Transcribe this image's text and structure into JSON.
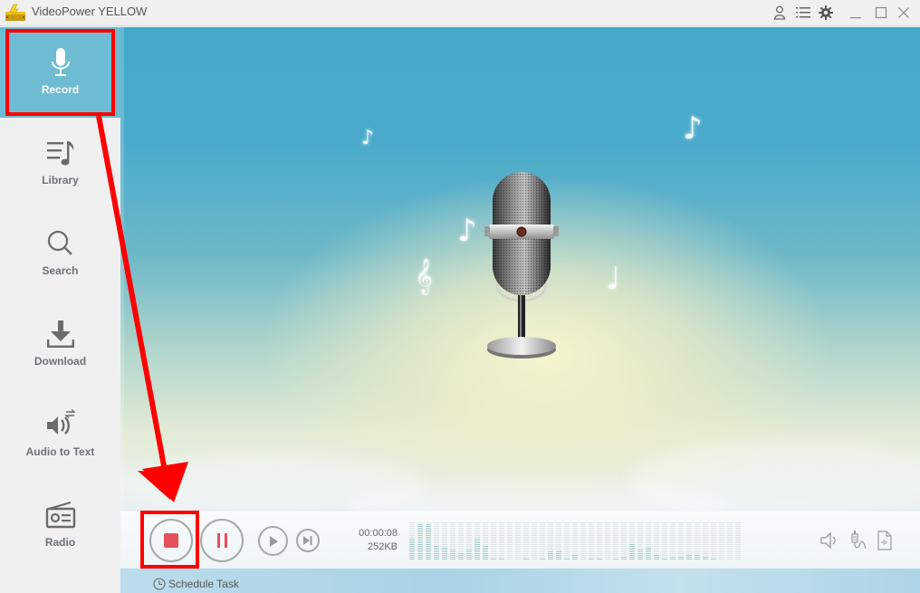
{
  "window": {
    "title": "VideoPower YELLOW",
    "title_icons": [
      "user-icon",
      "menu-list-icon",
      "gear-icon"
    ],
    "window_controls": [
      "minimize-icon",
      "maximize-icon",
      "close-icon"
    ]
  },
  "sidebar": {
    "items": [
      {
        "label": "Record",
        "icon": "microphone-icon",
        "active": true
      },
      {
        "label": "Library",
        "icon": "music-list-icon",
        "active": false
      },
      {
        "label": "Search",
        "icon": "search-icon",
        "active": false
      },
      {
        "label": "Download",
        "icon": "download-icon",
        "active": false
      },
      {
        "label": "Audio to Text",
        "icon": "speaker-convert-icon",
        "active": false
      },
      {
        "label": "Radio",
        "icon": "radio-icon",
        "active": false
      }
    ]
  },
  "stage": {
    "illustration": "vintage-microphone",
    "notes": [
      "♪",
      "♪",
      "♪",
      "𝄞",
      "♩"
    ]
  },
  "controls": {
    "stop_button": "stop",
    "pause_button": "pause",
    "play_button": "play",
    "next_button": "skip-next",
    "elapsed_time": "00:00:08",
    "file_size": "252KB",
    "level_meter_levels": [
      0.55,
      0.95,
      0.95,
      0.4,
      0.35,
      0.3,
      0.2,
      0.3,
      0.55,
      0.4,
      0.05,
      0.05,
      0.0,
      0.0,
      0.05,
      0.0,
      0.05,
      0.25,
      0.25,
      0.05,
      0.15,
      0.0,
      0.05,
      0.05,
      0.0,
      0.05,
      0.1,
      0.45,
      0.3,
      0.35,
      0.15,
      0.05,
      0.1,
      0.1,
      0.15,
      0.15,
      0.1,
      0.05,
      0.0,
      0.0,
      0.0
    ],
    "right_icons": [
      "speaker-volume-icon",
      "microphone-jack-icon",
      "audio-file-icon"
    ],
    "schedule_task_label": "Schedule Task"
  },
  "annotations": {
    "highlight_color": "#ff0000"
  },
  "colors": {
    "sidebar_active": "#6dbcd3",
    "record_red": "#e6505a",
    "sidebar_bg": "#f0f0f0"
  }
}
